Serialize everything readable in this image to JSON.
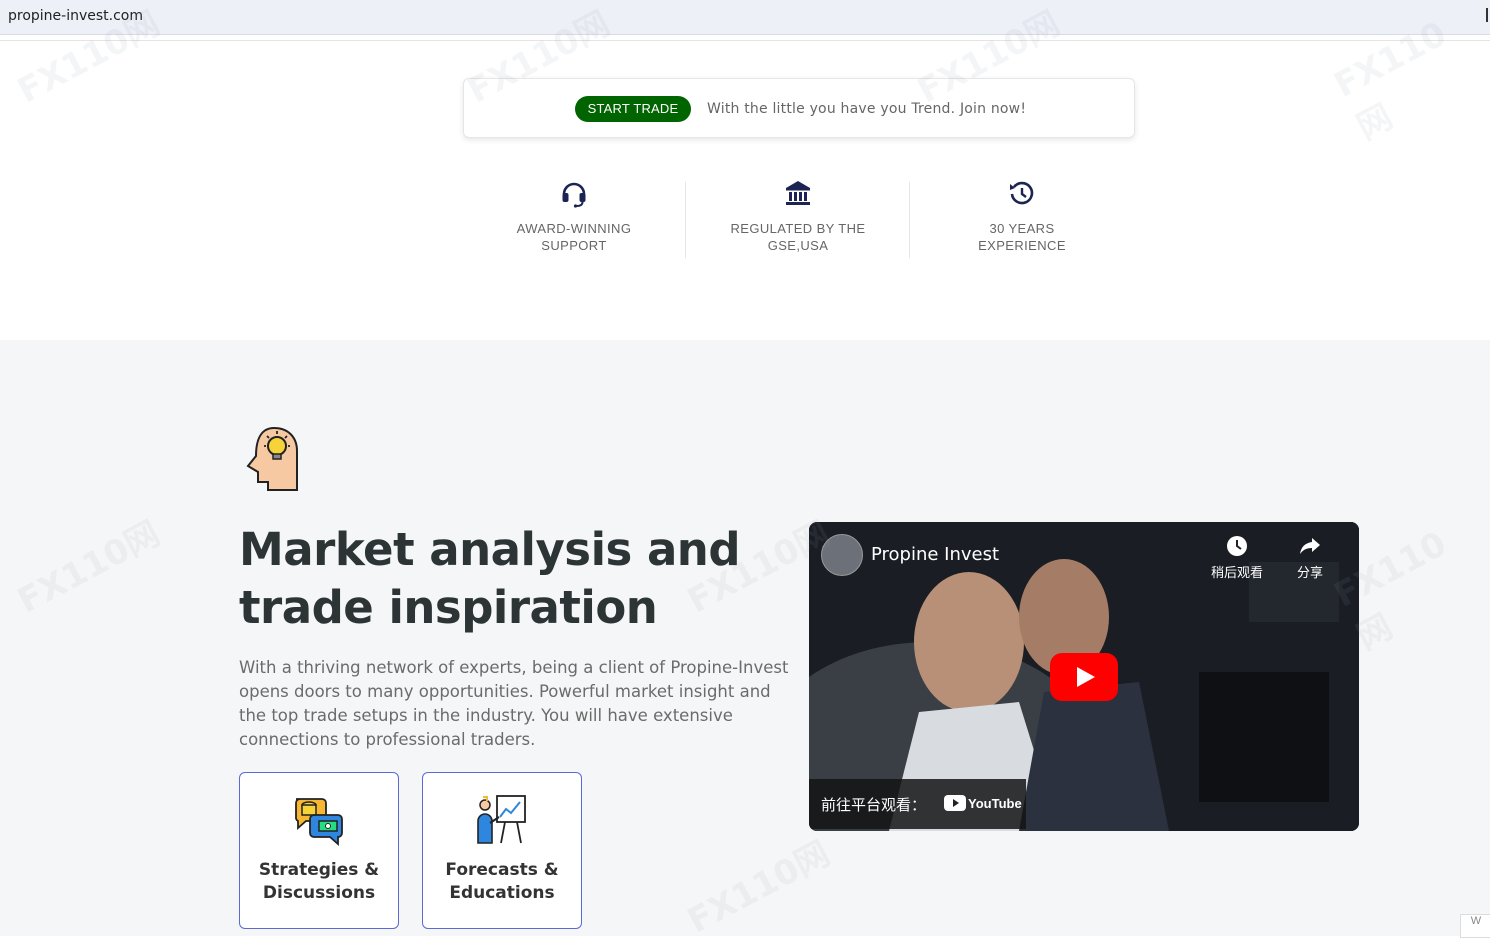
{
  "browser": {
    "url": "propine-invest.com"
  },
  "promo": {
    "button_label": "START TRADE",
    "message": "With the little you have you Trend. Join now!",
    "accent": "#006400"
  },
  "features": [
    {
      "icon": "headset-icon",
      "label": "AWARD-WINNING\nSUPPORT"
    },
    {
      "icon": "bank-icon",
      "label": "REGULATED BY THE\nGSE,USA"
    },
    {
      "icon": "history-icon",
      "label": "30 YEARS\nEXPERIENCE"
    }
  ],
  "hero": {
    "icon": "idea-head-icon",
    "title": "Market analysis and trade inspiration",
    "description": "With a thriving network of experts, being a client of Propine-Invest opens doors to many opportunities. Powerful market insight and the top trade setups in the industry. You will have extensive connections to professional traders."
  },
  "cards": [
    {
      "icon": "discussion-icon",
      "label": "Strategies &\nDiscussions"
    },
    {
      "icon": "presentation-icon",
      "label": "Forecasts &\nEducations"
    }
  ],
  "video": {
    "channel": "Propine Invest",
    "watch_later": "稍后观看",
    "share": "分享",
    "goto_label": "前往平台观看：",
    "platform": "YouTube",
    "play_color": "#ff0000"
  },
  "watermark": "FX110网",
  "corner_text": "W"
}
